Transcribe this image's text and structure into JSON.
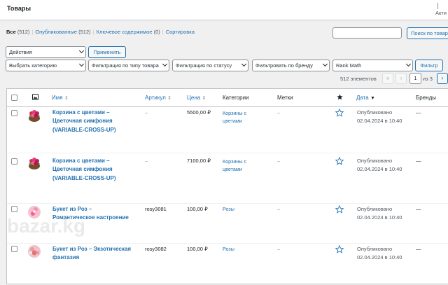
{
  "topbar": {
    "title": "Товары",
    "right_label": "Акти"
  },
  "filters_status": {
    "all": "Все",
    "all_count": "(512)",
    "published": "Опубликованные",
    "published_count": "(512)",
    "cornerstone": "Ключевое содержимое",
    "cornerstone_count": "(0)",
    "sorting": "Сортировка"
  },
  "search": {
    "button": "Поиск по товарам"
  },
  "bulk": {
    "action": "Действия",
    "apply": "Применить"
  },
  "filters": {
    "category": "Выбрать категорию",
    "product_type": "Фильтрация по типу товара",
    "stock_status": "Фильтрация по статусу",
    "brand": "Фильтровать по бренду",
    "rank_math": "Rank Math",
    "filter_button": "Фильтр"
  },
  "pagination": {
    "count": "512 элементов",
    "first": "«",
    "prev": "‹",
    "current": "1",
    "of_total": "из 3",
    "next": "›"
  },
  "columns": {
    "name": "Имя",
    "sku": "Артикул",
    "price": "Цена",
    "categories": "Категории",
    "tags": "Метки",
    "date": "Дата",
    "brands": "Бренды",
    "image_icon": "image-icon",
    "featured_icon": "star-icon"
  },
  "rows": [
    {
      "name1": "Корзина с цветами –",
      "name2": "Цветочная симфония",
      "name3": "(VARIABLE-CROSS-UP)",
      "sku": "–",
      "price": "5500,00 ₽",
      "cat1": "Корзины с",
      "cat2": "цветами",
      "tags": "–",
      "status": "Опубликовано",
      "date": "02.04.2024 в 10:40",
      "brand": "—"
    },
    {
      "name1": "Корзина с цветами –",
      "name2": "Цветочная симфония",
      "name3": "(VARIABLE-CROSS-UP)",
      "sku": "–",
      "price": "7100,00 ₽",
      "cat1": "Корзины с",
      "cat2": "цветами",
      "tags": "–",
      "status": "Опубликовано",
      "date": "02.04.2024 в 10:40",
      "brand": "—"
    },
    {
      "name1": "Букет из Роз –",
      "name2": "Романтическое настроение",
      "name3": "",
      "sku": "rosy3081",
      "price": "100,00 ₽",
      "cat1": "Розы",
      "cat2": "",
      "tags": "–",
      "status": "Опубликовано",
      "date": "02.04.2024 в 10:40",
      "brand": "—"
    },
    {
      "name1": "Букет из Роз – Экзотическая",
      "name2": "фантазия",
      "name3": "",
      "sku": "rosy3082",
      "price": "100,00 ₽",
      "cat1": "Розы",
      "cat2": "",
      "tags": "–",
      "status": "Опубликовано",
      "date": "02.04.2024 в 10:40",
      "brand": "—"
    }
  ],
  "watermark": "bazar.kg",
  "colors": {
    "link": "#2271b1",
    "border": "#c3c4c7",
    "bg": "#f0f0f1"
  }
}
